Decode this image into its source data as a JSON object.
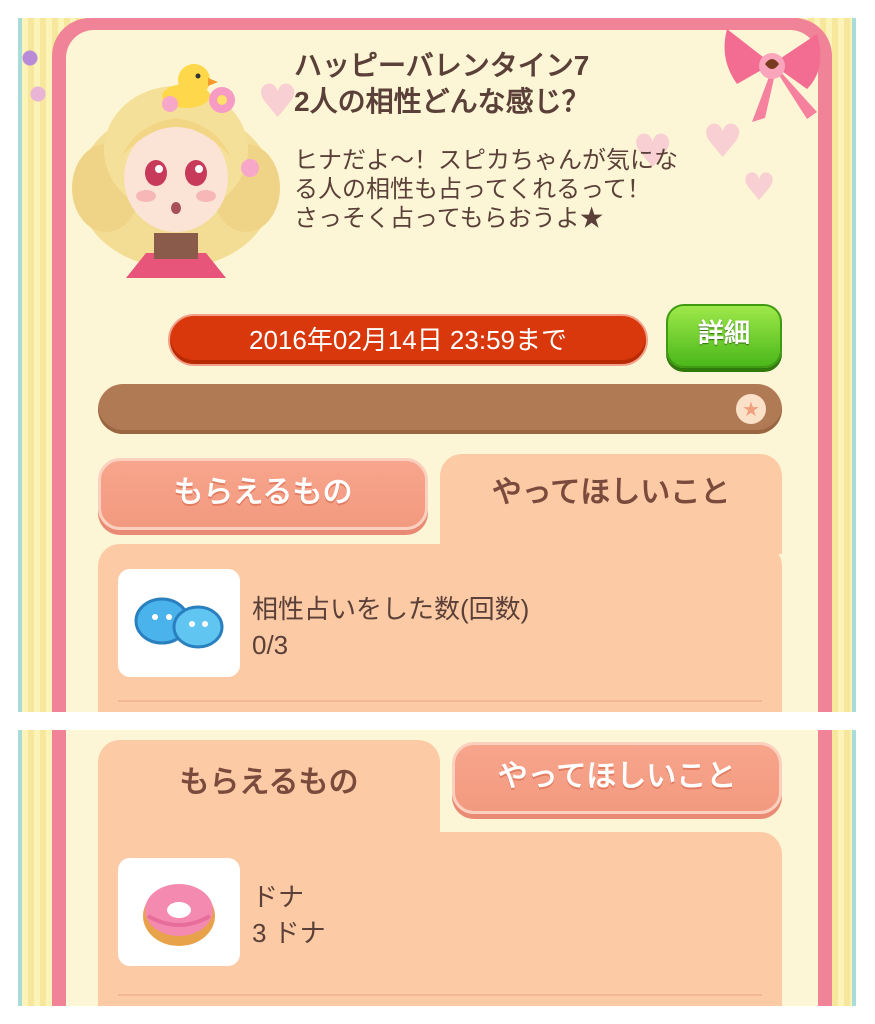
{
  "mission": {
    "title_line1": "ハッピーバレンタイン7",
    "title_line2": "2人の相性どんな感じ？",
    "description_lines": [
      "ヒナだよ～！スピカちゃんが気にな",
      "る人の相性も占ってくれるって！",
      "さっそく占ってもらおうよ★"
    ],
    "deadline": "2016年02月14日 23:59まで",
    "detail_button": "詳細",
    "progress_fraction": 0
  },
  "top_view": {
    "tabs": {
      "rewards": "もらえるもの",
      "tasks": "やってほしいこと"
    },
    "active_tab": "tasks",
    "item": {
      "icon": "blue-slime-pair-icon",
      "label": "相性占いをした数(回数)",
      "value": "0/3"
    }
  },
  "bottom_view": {
    "tabs": {
      "rewards": "もらえるもの",
      "tasks": "やってほしいこと"
    },
    "active_tab": "rewards",
    "item": {
      "icon": "pink-donut-icon",
      "label": "ドナ",
      "value": "3 ドナ"
    }
  },
  "colors": {
    "frame_pink": "#f08398",
    "cream": "#fdf6d6",
    "deadline_red": "#d8380c",
    "detail_green": "#4bb81a",
    "progress_brown": "#b07a55",
    "tab_salmon": "#f29a80",
    "content_peach": "#fccaa5",
    "text_brown": "#5a4038"
  }
}
